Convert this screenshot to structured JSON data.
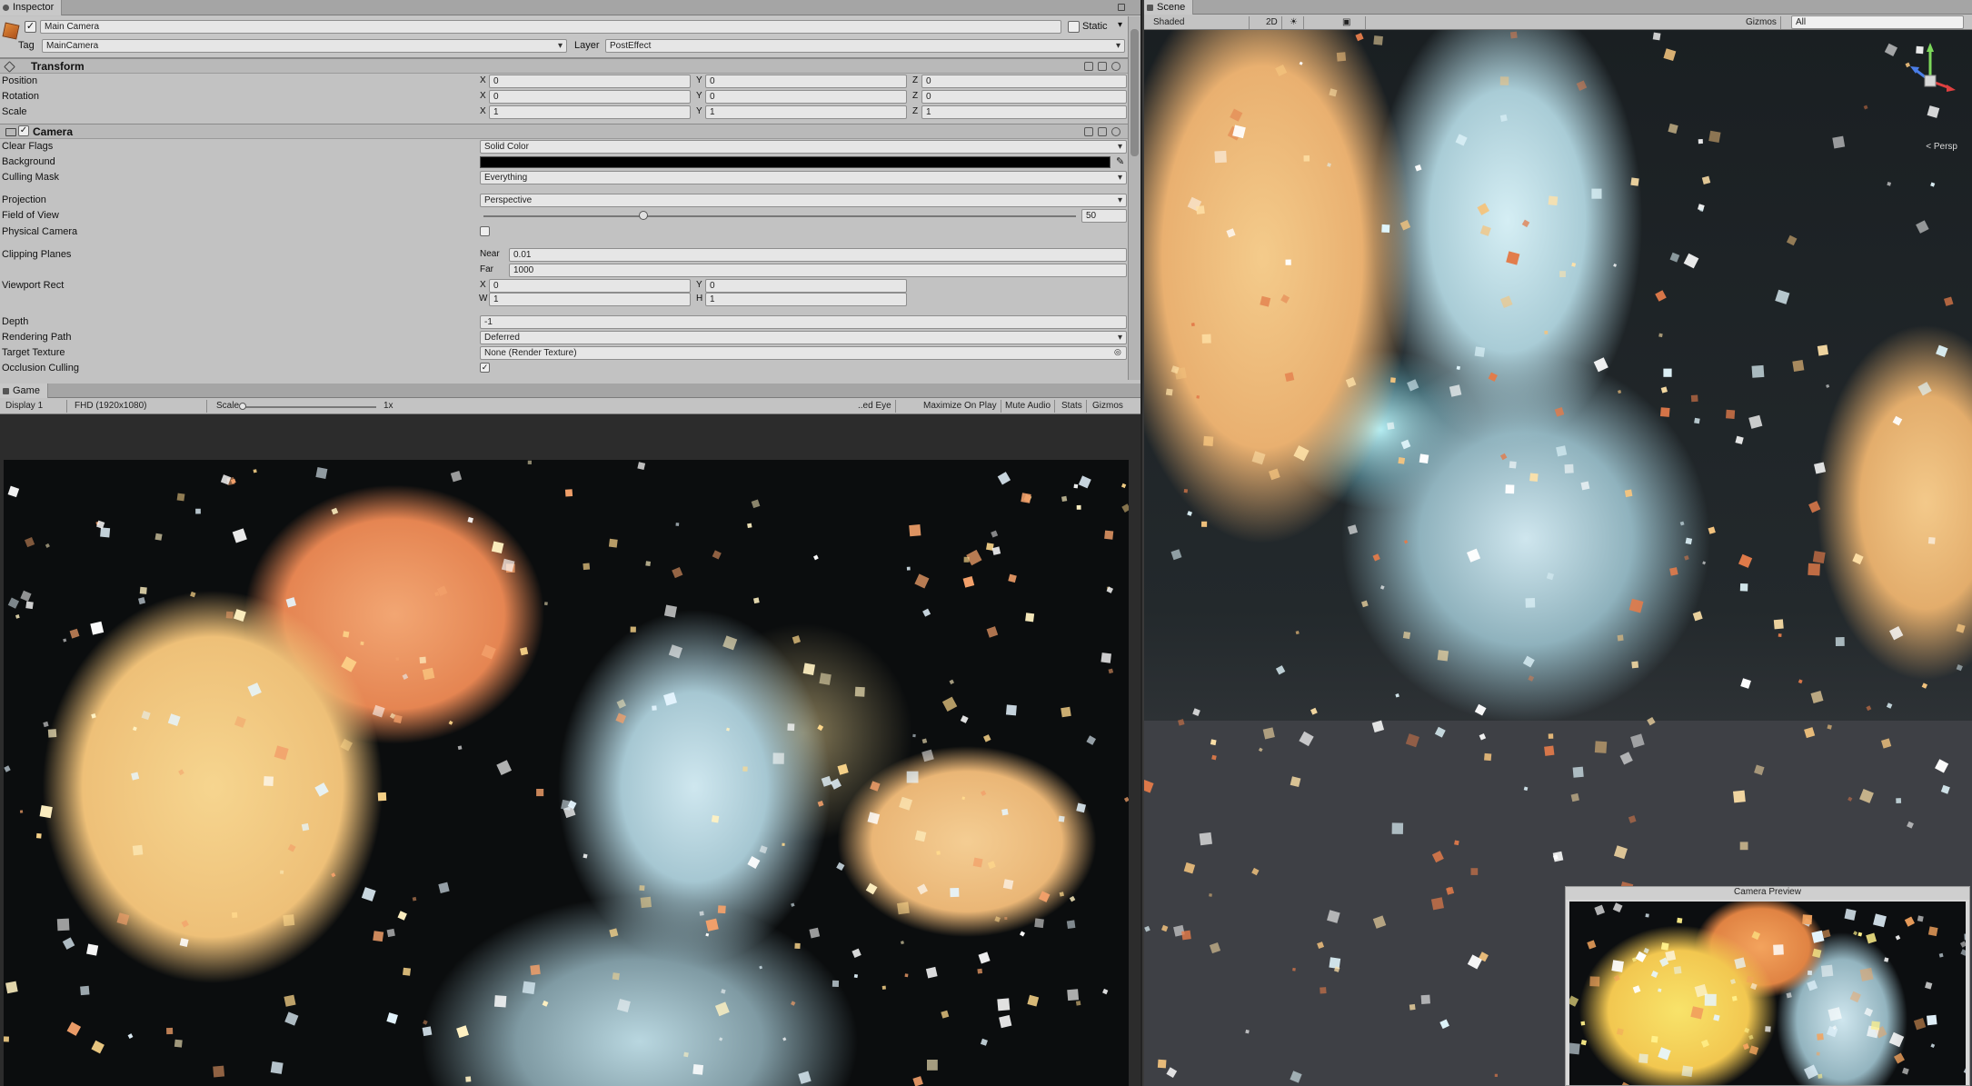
{
  "inspector": {
    "tab_label": "Inspector",
    "gameobject": {
      "name": "Main Camera",
      "static_label": "Static",
      "tag_label": "Tag",
      "tag_value": "MainCamera",
      "layer_label": "Layer",
      "layer_value": "PostEffect"
    },
    "transform": {
      "title": "Transform",
      "position": {
        "label": "Position",
        "x": "0",
        "y": "0",
        "z": "0"
      },
      "rotation": {
        "label": "Rotation",
        "x": "0",
        "y": "0",
        "z": "0"
      },
      "scale": {
        "label": "Scale",
        "x": "1",
        "y": "1",
        "z": "1"
      }
    },
    "camera": {
      "title": "Camera",
      "clear_flags": {
        "label": "Clear Flags",
        "value": "Solid Color"
      },
      "background_label": "Background",
      "background_color": "#000000",
      "culling_mask": {
        "label": "Culling Mask",
        "value": "Everything"
      },
      "projection": {
        "label": "Projection",
        "value": "Perspective"
      },
      "fov": {
        "label": "Field of View",
        "value": "50",
        "fraction": 0.27
      },
      "physical_camera_label": "Physical Camera",
      "clipping": {
        "label": "Clipping Planes",
        "near_label": "Near",
        "near": "0.01",
        "far_label": "Far",
        "far": "1000"
      },
      "viewport": {
        "label": "Viewport Rect",
        "x": "0",
        "y": "0",
        "w": "1",
        "h": "1"
      },
      "depth": {
        "label": "Depth",
        "value": "-1"
      },
      "rendering_path": {
        "label": "Rendering Path",
        "value": "Deferred"
      },
      "target_texture": {
        "label": "Target Texture",
        "value": "None (Render Texture)"
      },
      "occlusion_culling": {
        "label": "Occlusion Culling",
        "checked": true
      }
    },
    "axis": {
      "x": "X",
      "y": "Y",
      "z": "Z",
      "w": "W",
      "h": "H"
    }
  },
  "game": {
    "tab_label": "Game",
    "display": "Display 1",
    "resolution": "FHD (1920x1080)",
    "scale_label": "Scale",
    "scale_value": "1x",
    "scale_fraction": 0.02,
    "toolbar": [
      "Maximize On Play",
      "Mute Audio",
      "Stats",
      "Gizmos"
    ],
    "toolbar_prefix": "..ed Eye"
  },
  "scene": {
    "tab_label": "Scene",
    "shading": "Shaded",
    "mode_2d": "2D",
    "gizmos": "Gizmos",
    "search_placeholder": "All",
    "persp_label": "< Persp",
    "camera_preview_title": "Camera Preview"
  },
  "colors": {
    "panel_bg": "#c2c2c2",
    "accent_orange": "#e9b070",
    "accent_cyan": "#a9ccd6"
  }
}
